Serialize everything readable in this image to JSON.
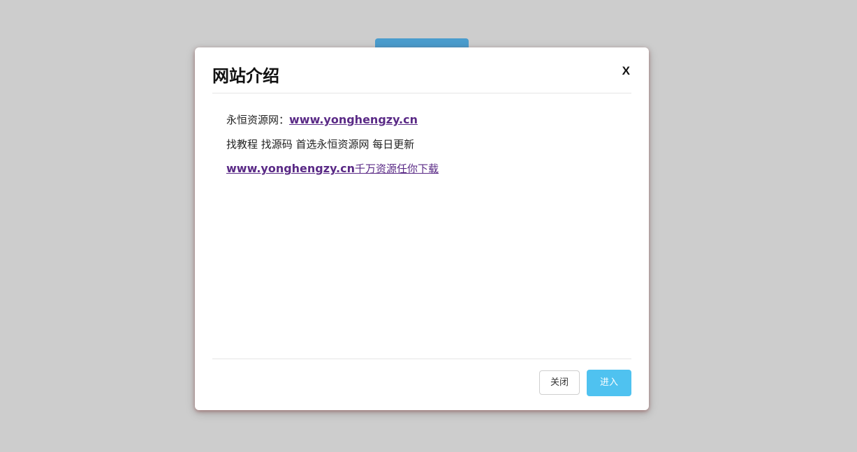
{
  "modal": {
    "title": "网站介绍",
    "close_icon_text": "X",
    "body": {
      "line1_prefix": "永恒资源网：",
      "line1_link": "www.yonghengzy.cn",
      "line2": "找教程 找源码 首选永恒资源网 每日更新",
      "line3_link_bold": "www.yonghengzy.cn",
      "line3_link_text": "千万资源任你下载"
    },
    "footer": {
      "close_label": "关闭",
      "enter_label": "进入"
    }
  },
  "colors": {
    "overlay": "#cdcdcd",
    "background_button": "#4a9ccd",
    "link": "#5a2a86",
    "enter_button": "#4fc2f0"
  }
}
